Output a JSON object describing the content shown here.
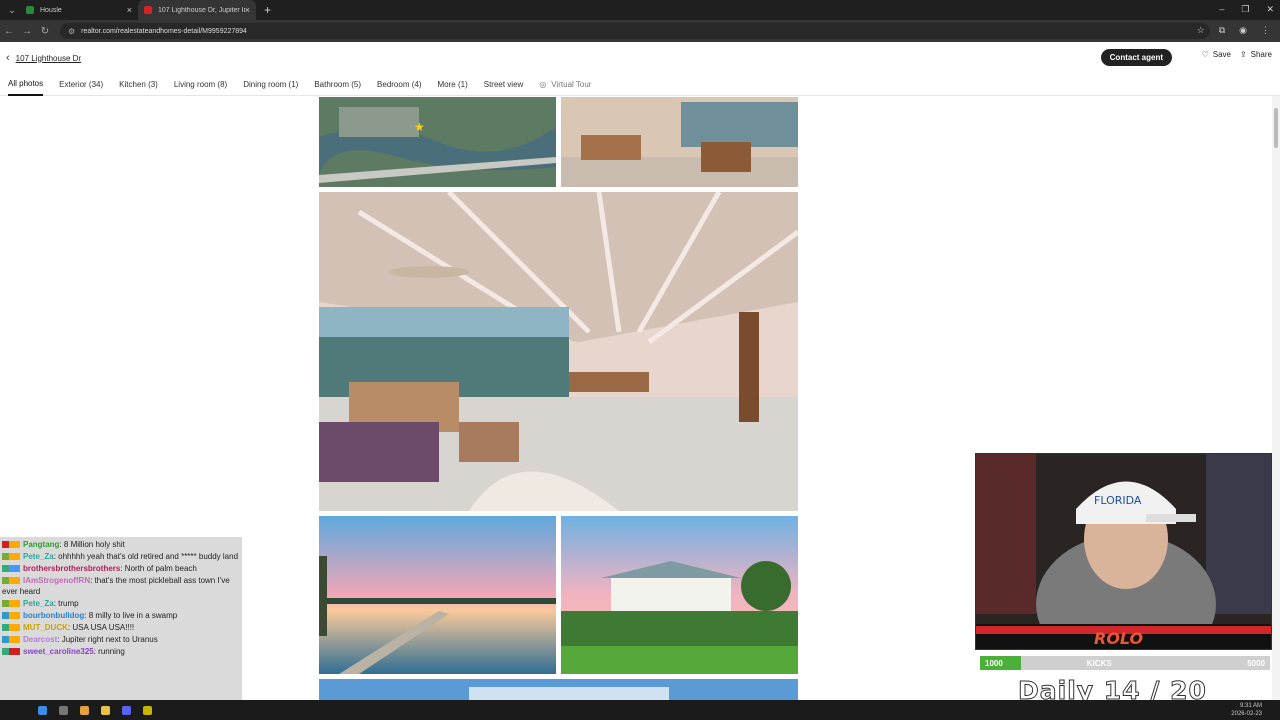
{
  "browser": {
    "tabs": [
      {
        "title": "Housle",
        "active": false,
        "favicon_color": "#2a8a3a"
      },
      {
        "title": "107 Lighthouse Dr, Jupiter Inle",
        "active": true,
        "favicon_color": "#d92228"
      }
    ],
    "url": "realtor.com/realestateandhomes-detail/M9959227894"
  },
  "listing": {
    "address_link": "107 Lighthouse Dr",
    "contact_label": "Contact agent",
    "save_label": "Save",
    "share_label": "Share"
  },
  "categories": [
    {
      "label": "All photos",
      "active": true
    },
    {
      "label": "Exterior (34)"
    },
    {
      "label": "Kitchen (3)"
    },
    {
      "label": "Living room (8)"
    },
    {
      "label": "Dining room (1)"
    },
    {
      "label": "Bathroom (5)"
    },
    {
      "label": "Bedroom (4)"
    },
    {
      "label": "More (1)"
    },
    {
      "label": "Street view"
    },
    {
      "label": "Virtual Tour"
    }
  ],
  "chat": [
    {
      "user": "Pangtang",
      "color": "#2e9e2e",
      "text": ": 8 Million holy shit"
    },
    {
      "user": "Pete_Za",
      "color": "#26a8a0",
      "text": ": ohhhhh yeah that's old retired and ***** buddy land"
    },
    {
      "user": "brothersbrothersbrothers",
      "color": "#b0225a",
      "text": ": North of palm beach"
    },
    {
      "user": "IAmStrogenoffRN",
      "color": "#c06ab5",
      "text": ": that's the most pickleball ass town I've ever heard"
    },
    {
      "user": "Pete_Za",
      "color": "#26a8a0",
      "text": ": trump"
    },
    {
      "user": "bourbonbulldog",
      "color": "#2f7fd0",
      "text": ": 8 milly to live in a swamp"
    },
    {
      "user": "MUT_DUCK",
      "color": "#c9a400",
      "text": ": USA USA USA!!!!"
    },
    {
      "user": "Dearcost",
      "color": "#b87ad8",
      "text": ": Jupiter right next to Uranus"
    },
    {
      "user": "sweet_caroline325",
      "color": "#8a3fd0",
      "text": ": running"
    }
  ],
  "overlay": {
    "kicks_min": "1000",
    "kicks_label": "KICKS",
    "kicks_max": "5000",
    "kicks_progress": 0.14,
    "daily_text": "Daily  14 / 20"
  },
  "clock": {
    "time": "9:31 AM",
    "date": "2026-02-23"
  }
}
